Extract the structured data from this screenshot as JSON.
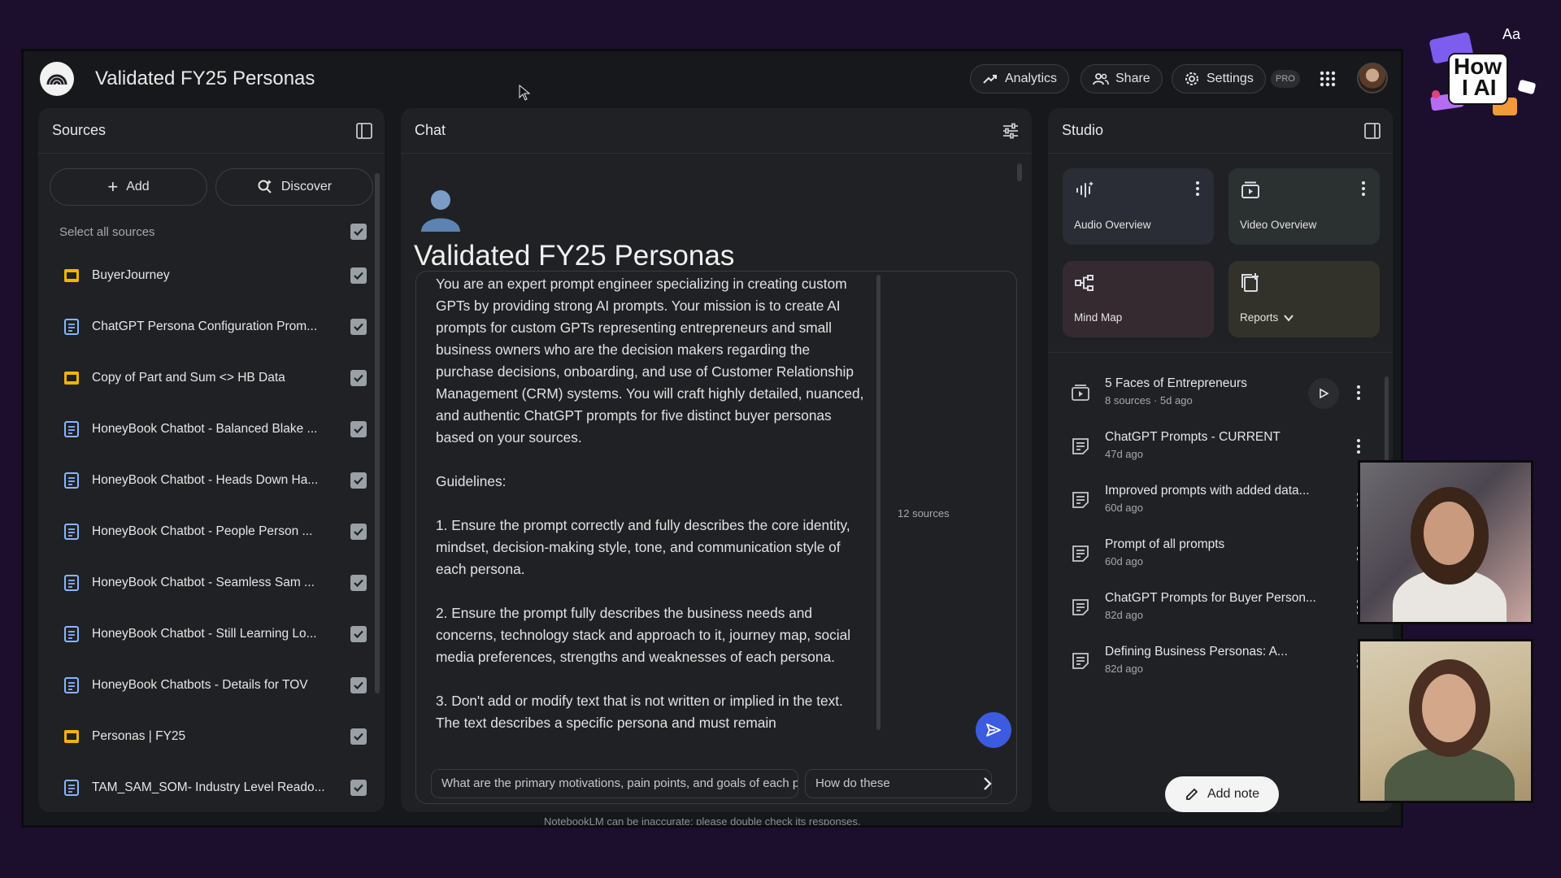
{
  "app": {
    "title": "Validated FY25 Personas",
    "disclaimer": "NotebookLM can be inaccurate; please double check its responses."
  },
  "topbar": {
    "analytics_label": "Analytics",
    "share_label": "Share",
    "settings_label": "Settings",
    "pro_badge": "PRO"
  },
  "sources": {
    "header": "Sources",
    "add_label": "Add",
    "discover_label": "Discover",
    "select_all_label": "Select all sources",
    "items": [
      {
        "label": "BuyerJourney",
        "icon": "slides-icon",
        "checked": true
      },
      {
        "label": "ChatGPT Persona Configuration Prom...",
        "icon": "doc-icon",
        "checked": true
      },
      {
        "label": "Copy of Part and Sum <> HB Data",
        "icon": "slides-icon",
        "checked": true
      },
      {
        "label": "HoneyBook Chatbot - Balanced Blake ...",
        "icon": "doc-icon",
        "checked": true
      },
      {
        "label": "HoneyBook Chatbot - Heads Down Ha...",
        "icon": "doc-icon",
        "checked": true
      },
      {
        "label": "HoneyBook Chatbot - People Person ...",
        "icon": "doc-icon",
        "checked": true
      },
      {
        "label": "HoneyBook Chatbot - Seamless Sam ...",
        "icon": "doc-icon",
        "checked": true
      },
      {
        "label": "HoneyBook Chatbot - Still Learning Lo...",
        "icon": "doc-icon",
        "checked": true
      },
      {
        "label": "HoneyBook Chatbots - Details for TOV",
        "icon": "doc-icon",
        "checked": true
      },
      {
        "label": "Personas | FY25",
        "icon": "slides-icon",
        "checked": true
      },
      {
        "label": "TAM_SAM_SOM- Industry Level Reado...",
        "icon": "doc-icon",
        "checked": true
      }
    ]
  },
  "chat": {
    "header": "Chat",
    "notebook_title": "Validated FY25 Personas",
    "prompt_text": "You are an expert prompt engineer specializing in creating custom GPTs by providing strong AI prompts. Your mission is to create AI prompts for custom GPTs representing entrepreneurs and small business owners who are the decision makers regarding the purchase decisions, onboarding, and use of Customer Relationship Management (CRM) systems. You will craft highly detailed, nuanced, and authentic ChatGPT prompts for five distinct buyer personas based on your sources.\n\nGuidelines:\n\n1. Ensure the prompt correctly and fully describes the core identity, mindset, decision-making style, tone, and communication style of each persona.\n\n2. Ensure the prompt fully describes the business needs and concerns, technology stack and approach to it, journey map, social media preferences, strengths and weaknesses of each persona.\n\n3. Don't add or modify text that is not written or implied in the text. The text describes a specific persona and must remain",
    "sources_count": "12 sources",
    "suggestions": [
      "What are the primary motivations, pain points, and goals of each persona?",
      "How do these"
    ]
  },
  "studio": {
    "header": "Studio",
    "tiles": [
      {
        "label": "Audio Overview",
        "icon": "audio-wave-icon",
        "color": "#2a2d35"
      },
      {
        "label": "Video Overview",
        "icon": "video-icon",
        "color": "#2b3030"
      },
      {
        "label": "Mind Map",
        "icon": "mind-map-icon",
        "color": "#352a30"
      },
      {
        "label": "Reports",
        "icon": "reports-icon",
        "color": "#33322a"
      }
    ],
    "notes": [
      {
        "title": "5 Faces of Entrepreneurs",
        "meta": "8 sources · 5d ago",
        "icon": "video-icon"
      },
      {
        "title": "ChatGPT Prompts - CURRENT",
        "meta": "47d ago",
        "icon": "note-icon"
      },
      {
        "title": "Improved prompts with added data...",
        "meta": "60d ago",
        "icon": "note-icon"
      },
      {
        "title": "Prompt of all prompts",
        "meta": "60d ago",
        "icon": "note-icon"
      },
      {
        "title": "ChatGPT Prompts for Buyer Person...",
        "meta": "82d ago",
        "icon": "note-icon"
      },
      {
        "title": "Defining Business Personas: A...",
        "meta": "82d ago",
        "icon": "note-icon"
      }
    ],
    "add_note_label": "Add note"
  },
  "overlay": {
    "logo_top": "Aa",
    "logo_line1": "How",
    "logo_line2": "I AI"
  },
  "colors": {
    "background": "#1c0f2e",
    "panel": "#202124",
    "accent_send": "#3d5be0",
    "slides_icon": "#f5b400",
    "doc_icon": "#8ab4f8"
  }
}
